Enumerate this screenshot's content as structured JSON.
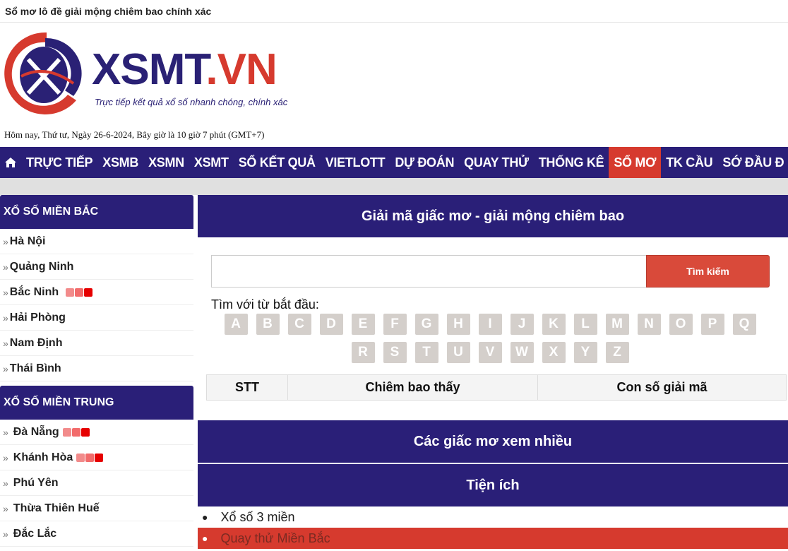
{
  "topbar": {
    "title": "Sổ mơ lô đề giải mộng chiêm bao chính xác"
  },
  "logo": {
    "brand": "XSMT",
    "tld": ".VN",
    "slogan": "Trực tiếp kết quả xổ số nhanh chóng, chính xác",
    "icon": "xsmt-logo-icon"
  },
  "datetime": "Hôm nay, Thứ tư, Ngày 26-6-2024, Bây giờ là 10 giờ 7 phút (GMT+7)",
  "nav": {
    "home_icon": "home-icon",
    "items": [
      "TRỰC TIẾP",
      "XSMB",
      "XSMN",
      "XSMT",
      "SỔ KẾT QUẢ",
      "VIETLOTT",
      "DỰ ĐOÁN",
      "QUAY THỬ",
      "THỐNG KÊ",
      "SỔ MƠ",
      "TK CẦU",
      "SỚ ĐẦU Đ"
    ],
    "active": "SỔ MƠ"
  },
  "sidebar": {
    "north": {
      "title": "XỔ SỐ MIỀN BẮC",
      "items": [
        "Hà Nội",
        "Quảng Ninh",
        "Bắc Ninh",
        "Hải Phòng",
        "Nam Định",
        "Thái Bình"
      ]
    },
    "central": {
      "title": "XỔ SỐ MIỀN TRUNG",
      "items": [
        "Đà Nẵng",
        "Khánh Hòa",
        "Phú Yên",
        "Thừa Thiên Huế",
        "Đắc Lắc"
      ]
    },
    "chevron": "»"
  },
  "main": {
    "title": "Giải mã giấc mơ - giải mộng chiêm bao",
    "search": {
      "placeholder": "",
      "button": "Tìm kiếm"
    },
    "start_label": "Tìm với từ bắt đầu:",
    "letters": [
      "A",
      "B",
      "C",
      "D",
      "E",
      "F",
      "G",
      "H",
      "I",
      "J",
      "K",
      "L",
      "M",
      "N",
      "O",
      "P",
      "Q",
      "R",
      "S",
      "T",
      "U",
      "V",
      "W",
      "X",
      "Y",
      "Z"
    ],
    "table": {
      "headers": [
        "STT",
        "Chiêm bao thấy",
        "Con số giải mã"
      ]
    },
    "popular_title": "Các giấc mơ xem nhiều",
    "utility_title": "Tiện ích",
    "utilities": [
      "Xổ số 3 miền",
      "Quay thử Miền Bắc"
    ]
  },
  "colors": {
    "primary": "#2a1f78",
    "accent": "#d63a2e",
    "letter_bg": "#d4cfcb"
  }
}
